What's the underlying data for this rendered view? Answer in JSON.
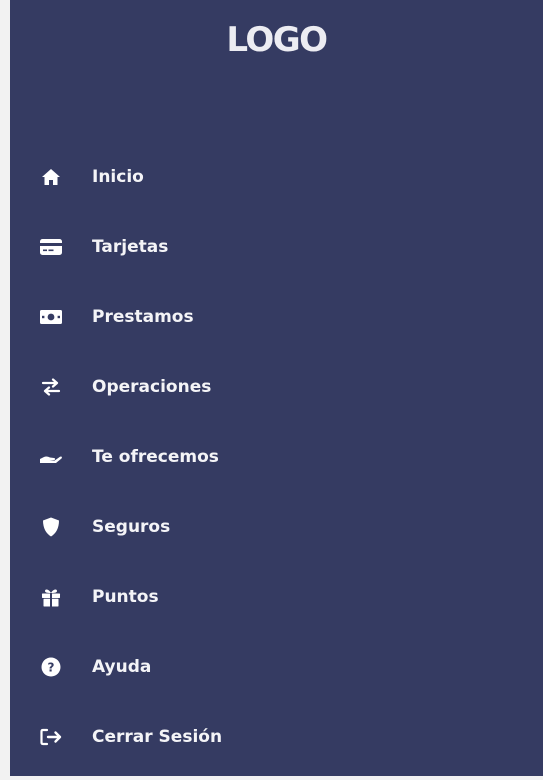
{
  "sidebar": {
    "logo_text": "LOGO",
    "background_color": "#353b62",
    "items": [
      {
        "label": "Inicio",
        "icon": "home-icon"
      },
      {
        "label": "Tarjetas",
        "icon": "credit-card-icon"
      },
      {
        "label": "Prestamos",
        "icon": "money-bill-icon"
      },
      {
        "label": "Operaciones",
        "icon": "exchange-arrows-icon"
      },
      {
        "label": "Te ofrecemos",
        "icon": "hand-holding-icon"
      },
      {
        "label": "Seguros",
        "icon": "shield-icon"
      },
      {
        "label": "Puntos",
        "icon": "gift-icon"
      },
      {
        "label": "Ayuda",
        "icon": "question-circle-icon"
      },
      {
        "label": "Cerrar Sesión",
        "icon": "sign-out-icon"
      }
    ]
  }
}
